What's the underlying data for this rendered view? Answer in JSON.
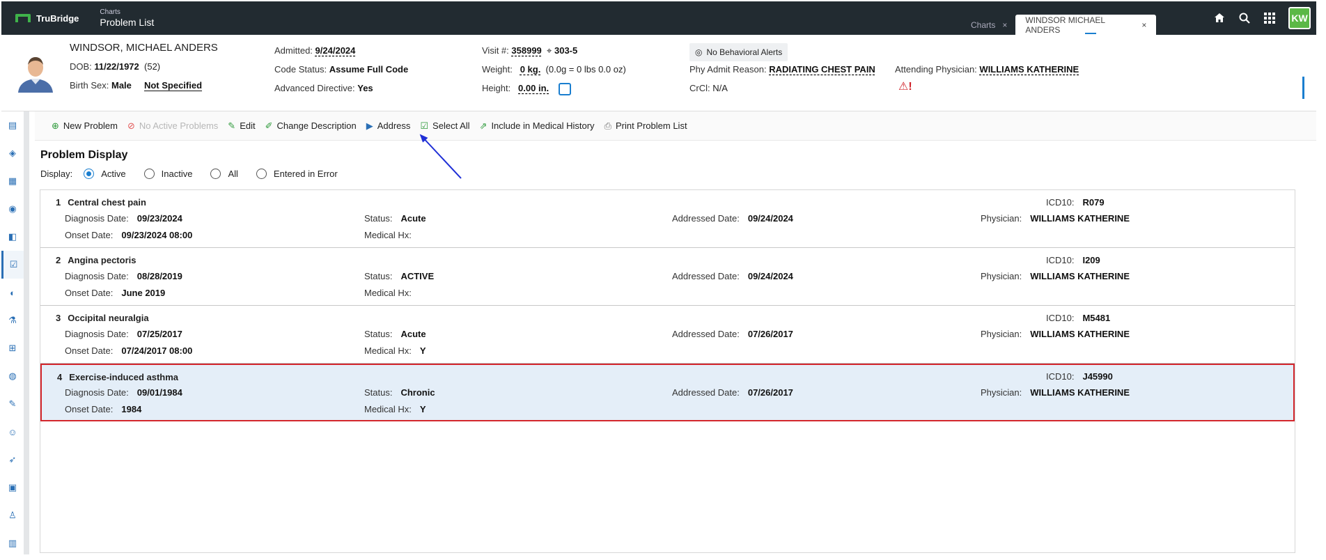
{
  "topbar": {
    "brand": "TruBridge",
    "app_sub": "Charts",
    "app_main": "Problem List",
    "tabs": [
      {
        "label": "Charts",
        "close": "×"
      },
      {
        "label": "WINDSOR MICHAEL ANDERS",
        "close": "×"
      }
    ],
    "icons": [
      "home-icon",
      "search-icon",
      "apps-grid-icon"
    ],
    "user_initials": "KW"
  },
  "patient": {
    "last_name": "WINDSOR",
    "first_middle": ", MICHAEL ANDERS",
    "dob_label": "DOB:",
    "dob": "11/22/1972",
    "age": "(52)",
    "birth_sex_label": "Birth Sex:",
    "birth_sex": "Male",
    "gender_identity": "Not Specified",
    "admitted_label": "Admitted:",
    "admitted": "9/24/2024",
    "code_status_label": "Code Status:",
    "code_status": "Assume Full Code",
    "adv_dir_label": "Advanced Directive:",
    "adv_dir": "Yes",
    "visit_label": "Visit #:",
    "visit": "358999",
    "room": "303-5",
    "weight_label": "Weight:",
    "weight": "0 kg.",
    "weight_detail": "(0.0g = 0 lbs 0.0 oz)",
    "height_label": "Height:",
    "height": "0.00 in.",
    "behavioral": "No Behavioral Alerts",
    "phy_admit_label": "Phy Admit Reason:",
    "phy_admit": "RADIATING CHEST PAIN",
    "crcl_label": "CrCl:",
    "crcl": "N/A",
    "attending_label": "Attending Physician:",
    "attending": "WILLIAMS KATHERINE"
  },
  "toolbar": {
    "new_problem": "New Problem",
    "no_active": "No Active Problems",
    "edit": "Edit",
    "change_desc": "Change Description",
    "address": "Address",
    "select_all": "Select All",
    "include_hx": "Include in Medical History",
    "print": "Print Problem List"
  },
  "display": {
    "title": "Problem Display",
    "label": "Display:",
    "options": [
      "Active",
      "Inactive",
      "All",
      "Entered in Error"
    ],
    "selected": "Active"
  },
  "labels": {
    "diagnosis_date": "Diagnosis Date:",
    "onset_date": "Onset Date:",
    "status": "Status:",
    "medical_hx": "Medical Hx:",
    "addressed_date": "Addressed Date:",
    "icd10": "ICD10:",
    "physician": "Physician:"
  },
  "problems": [
    {
      "num": "1",
      "name": "Central chest pain",
      "diagnosis_date": "09/23/2024",
      "onset_date": "09/23/2024 08:00",
      "status": "Acute",
      "medical_hx": "",
      "addressed_date": "09/24/2024",
      "icd10": "R079",
      "physician": "WILLIAMS KATHERINE"
    },
    {
      "num": "2",
      "name": "Angina pectoris",
      "diagnosis_date": "08/28/2019",
      "onset_date": "June 2019",
      "status": "ACTIVE",
      "medical_hx": "",
      "addressed_date": "09/24/2024",
      "icd10": "I209",
      "physician": "WILLIAMS KATHERINE"
    },
    {
      "num": "3",
      "name": "Occipital neuralgia",
      "diagnosis_date": "07/25/2017",
      "onset_date": "07/24/2017 08:00",
      "status": "Acute",
      "medical_hx": "Y",
      "addressed_date": "07/26/2017",
      "icd10": "M5481",
      "physician": "WILLIAMS KATHERINE"
    },
    {
      "num": "4",
      "name": "Exercise-induced asthma",
      "diagnosis_date": "09/01/1984",
      "onset_date": "1984",
      "status": "Chronic",
      "medical_hx": "Y",
      "addressed_date": "07/26/2017",
      "icd10": "J45990",
      "physician": "WILLIAMS KATHERINE"
    }
  ],
  "colors": {
    "topbar": "#222b31",
    "accent": "#1a7ecf",
    "selection_border": "#d3262c",
    "selection_bg": "#e4eef8",
    "annotation_arrow": "#1f2fd6"
  }
}
